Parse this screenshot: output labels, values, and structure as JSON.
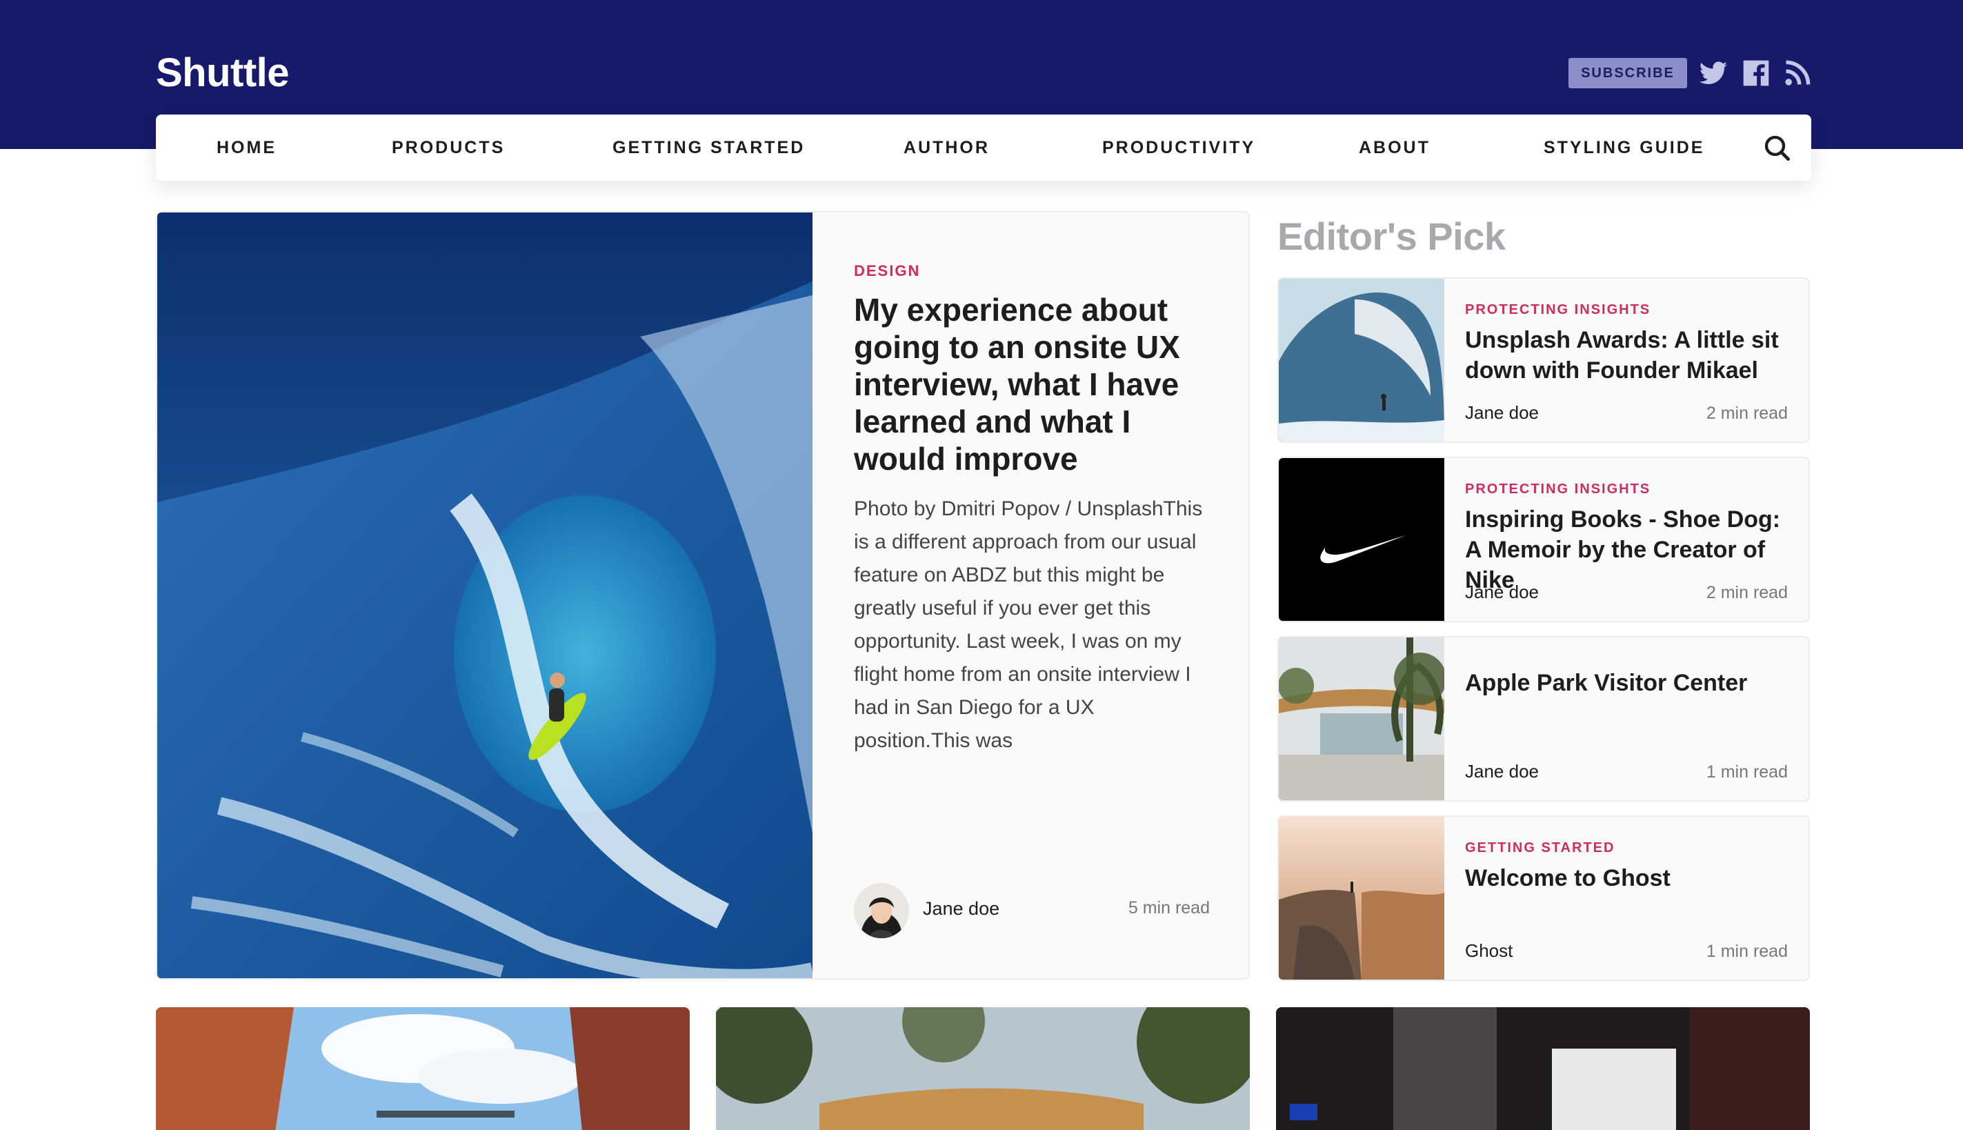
{
  "brand": {
    "name": "Shuttle"
  },
  "header": {
    "subscribe_label": "SUBSCRIBE",
    "social_icons": [
      "twitter-icon",
      "facebook-icon",
      "rss-icon"
    ]
  },
  "nav": {
    "items": [
      "HOME",
      "PRODUCTS",
      "GETTING STARTED",
      "AUTHOR",
      "PRODUCTIVITY",
      "ABOUT",
      "STYLING GUIDE"
    ],
    "search_icon": "search-icon"
  },
  "featured": {
    "tag": "DESIGN",
    "title": "My experience about going to an onsite UX interview, what I have learned and what I would improve",
    "excerpt": "Photo by Dmitri Popov / UnsplashThis is a different approach from our usual feature on ABDZ but this might be greatly useful if you ever get this opportunity. Last week, I was on my flight home from an onsite interview I had in San Diego for a UX position.This was",
    "author": "Jane doe",
    "read_time": "5 min read"
  },
  "editors_pick": {
    "heading": "Editor's Pick",
    "posts": [
      {
        "tag": "PROTECTING INSIGHTS",
        "title": "Unsplash Awards: A little sit down with Founder Mikael",
        "author": "Jane doe",
        "read_time": "2 min read"
      },
      {
        "tag": "PROTECTING INSIGHTS",
        "title": "Inspiring Books - Shoe Dog: A Memoir by the Creator of Nike",
        "author": "Jane doe",
        "read_time": "2 min read"
      },
      {
        "tag": "",
        "title": "Apple Park Visitor Center",
        "author": "Jane doe",
        "read_time": "1 min read"
      },
      {
        "tag": "GETTING STARTED",
        "title": "Welcome to Ghost",
        "author": "Ghost",
        "read_time": "1 min read"
      }
    ]
  },
  "colors": {
    "header_bg": "#171a6b",
    "accent_tag": "#d02a5f",
    "subscribe_bg": "#8b8fc9"
  }
}
